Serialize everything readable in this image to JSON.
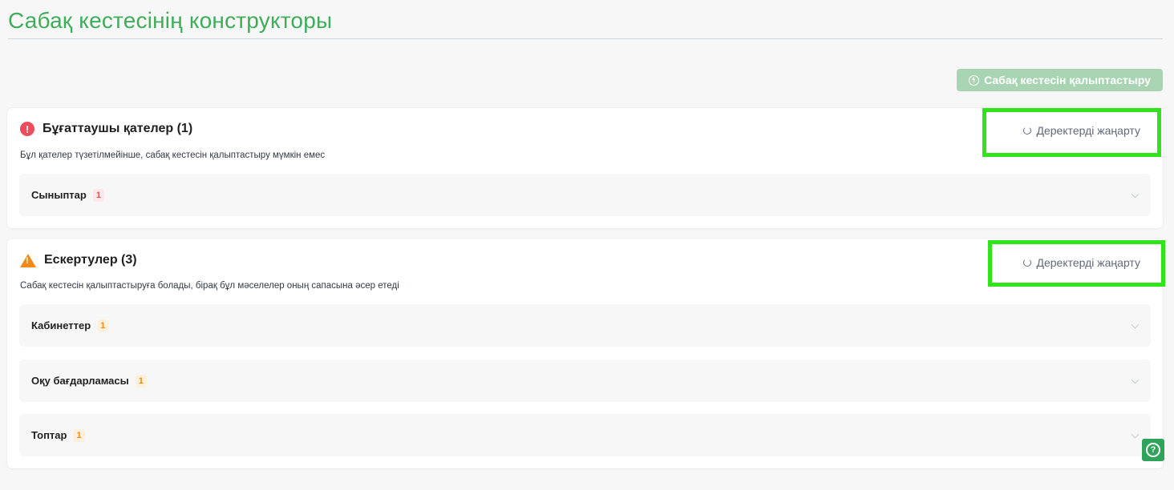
{
  "page": {
    "title": "Сабақ кестесінің конструкторы",
    "generate_label": "Сабақ кестесін қалыптастыру"
  },
  "errors": {
    "title": "Бұғаттаушы қателер (1)",
    "description": "Бұл қателер түзетілмейінше, сабақ кестесін қалыптастыру мүмкін емес",
    "refresh_label": "Деректерді жаңарту",
    "items": [
      {
        "label": "Сыныптар",
        "count": "1"
      }
    ]
  },
  "warnings": {
    "title": "Ескертулер (3)",
    "description": "Сабақ кестесін қалыптастыруға болады, бірақ бұл мәселелер оның сапасына әсер етеді",
    "refresh_label": "Деректерді жаңарту",
    "items": [
      {
        "label": "Кабинеттер",
        "count": "1"
      },
      {
        "label": "Оқу бағдарламасы",
        "count": "1"
      },
      {
        "label": "Топтар",
        "count": "1"
      }
    ]
  },
  "colors": {
    "accent": "#3fae5a",
    "error": "#ef4b5a",
    "warning": "#f08a1c",
    "highlight": "#31e31a"
  },
  "icons": {
    "error": "alert-circle-icon",
    "warning": "warning-triangle-icon",
    "refresh": "refresh-icon",
    "generate": "upload-icon",
    "help": "help-circle-icon",
    "chevron": "chevron-down-icon"
  }
}
